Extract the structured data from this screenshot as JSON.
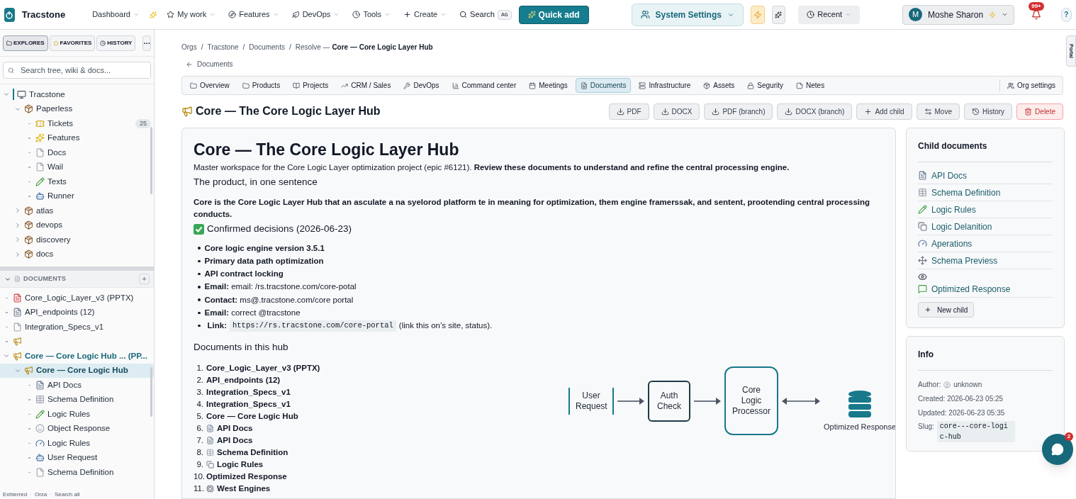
{
  "app": {
    "name": "Tracstone"
  },
  "nav": [
    {
      "label": "Dashboard"
    },
    {
      "label": "My work"
    },
    {
      "label": "Features"
    },
    {
      "label": "DevOps"
    },
    {
      "label": "Tools"
    },
    {
      "label": "Create"
    }
  ],
  "search": {
    "label": "Search",
    "shortcut": "AG"
  },
  "quick_add": {
    "label": "Quick add"
  },
  "system_settings": {
    "label": "System Settings"
  },
  "recent": {
    "label": "Recent"
  },
  "user": {
    "initial": "M",
    "name": "Moshe Sharon"
  },
  "notifications": {
    "count": "99+"
  },
  "help": {
    "label": "?"
  },
  "portal_tab": {
    "label": "Portal"
  },
  "sidebar": {
    "tabs": [
      {
        "label": "EXPLORES",
        "selected": true
      },
      {
        "label": "FAVORITES",
        "selected": false
      },
      {
        "label": "HISTORY",
        "selected": false
      }
    ],
    "more": "···",
    "search_placeholder": "Search tree, wiki & docs...",
    "tree": [
      {
        "label": "Tracstone",
        "kind": "root",
        "expanded": true,
        "selected": false,
        "children": [
          {
            "label": "Paperless",
            "kind": "box",
            "expanded": true,
            "selected": false,
            "children": [
              {
                "label": "Tickets",
                "kind": "ticket",
                "count": "25",
                "selected": false
              },
              {
                "label": "Features",
                "kind": "sparkle",
                "selected": false
              },
              {
                "label": "Docs",
                "kind": "page",
                "selected": false
              },
              {
                "label": "Wail",
                "kind": "page",
                "selected": false
              },
              {
                "label": "Texts",
                "kind": "pencil",
                "selected": false
              },
              {
                "label": "Runner",
                "kind": "robot",
                "selected": false
              }
            ]
          },
          {
            "label": "atlas",
            "kind": "box",
            "expanded": false,
            "selected": false
          },
          {
            "label": "devops",
            "kind": "box",
            "expanded": false,
            "selected": false
          },
          {
            "label": "discovery",
            "kind": "box",
            "expanded": false,
            "selected": false
          },
          {
            "label": "docs",
            "kind": "box",
            "expanded": false,
            "selected": false
          }
        ]
      }
    ],
    "documents_header": "DOCUMENTS",
    "add_label": "+",
    "documents": [
      {
        "label": "Core_Logic_Layer_v3 (PPTX)",
        "kind": "pptx",
        "selected": false
      },
      {
        "label": "API_endpoints (12)",
        "kind": "doc",
        "selected": false
      },
      {
        "label": "Integration_Specs_v1",
        "kind": "page",
        "selected": false
      },
      {
        "kind": "megaphone",
        "selected": false
      },
      {
        "label": "Core — Core Logic Hub ... (PP...",
        "kind": "megaphone",
        "expanded": true,
        "selected": false,
        "children": [
          {
            "label": "Core — Core Logic Hub",
            "kind": "megaphone",
            "expanded": true,
            "selected": true,
            "children": [
              {
                "label": "API Docs",
                "kind": "doc",
                "selected": false
              },
              {
                "label": "Schema Definition",
                "kind": "grid",
                "selected": false
              },
              {
                "label": "Logic Rules",
                "kind": "pencil",
                "selected": false
              },
              {
                "label": "Object Response",
                "kind": "face",
                "selected": false
              },
              {
                "label": "Logic Rules",
                "kind": "gauge",
                "selected": false
              },
              {
                "label": "User Request",
                "kind": "robot",
                "selected": false
              },
              {
                "label": "Schema Definition",
                "kind": "page",
                "selected": false
              }
            ]
          }
        ]
      }
    ],
    "footer": [
      "Exhlerred",
      "Orza",
      "Search all"
    ],
    "footer_separator": "·"
  },
  "breadcrumb": [
    "Orgs",
    "Tracstone",
    "Documents"
  ],
  "breadcrumb_separator": "/",
  "breadcrumb_current": {
    "prefix": "Resolve —",
    "label": "Core — Core Logic Layer Hub"
  },
  "back_link": "Documents",
  "tabs": [
    {
      "label": "Overview",
      "selected": false
    },
    {
      "label": "Products",
      "selected": false
    },
    {
      "label": "Projects",
      "selected": false
    },
    {
      "label": "CRM / Sales",
      "selected": false
    },
    {
      "label": "DevOps",
      "selected": false
    },
    {
      "label": "Command center",
      "selected": false
    },
    {
      "label": "Meetings",
      "selected": false
    },
    {
      "label": "Documents",
      "selected": true
    },
    {
      "label": "Infrastructure",
      "selected": false
    },
    {
      "label": "Assets",
      "selected": false
    },
    {
      "label": "Segurity",
      "selected": false
    },
    {
      "label": "Netes",
      "selected": false
    }
  ],
  "org_settings": "Org settings",
  "page_title": "Core — The Core Logic Layer Hub",
  "actions": [
    {
      "label": "PDF",
      "kind": "download"
    },
    {
      "label": "DOCX",
      "kind": "download"
    },
    {
      "label": "PDF (branch)",
      "kind": "download"
    },
    {
      "label": "DOCX (branch)",
      "kind": "download"
    },
    {
      "label": "Add child",
      "kind": "add"
    },
    {
      "label": "Move",
      "kind": "move"
    },
    {
      "label": "History",
      "kind": "history"
    },
    {
      "label": "Delete",
      "kind": "danger"
    }
  ],
  "document": {
    "title": "Core — The Core Logic Layer Hub",
    "intro": "Master workspace for the Core Logic Layer optimization project (epic #6121). **Review these documents to understand and refine the central processing engine.**",
    "subtitle": "The product, in one sentence",
    "summary": "Core is the Core Logic Layer Hub that an asculate a na syelorod platform te in meaning for optimization, them engine framerssak, and sentent, prootending central processing conducts.",
    "decisions_heading": "Confirmed decisions (2026-06-23)",
    "decisions": [
      {
        "kind": "strong",
        "text": "Core logic engine version 3.5.1"
      },
      {
        "kind": "strong",
        "text": "Primary data path optimization"
      },
      {
        "kind": "strong",
        "text": "API contract locking"
      },
      {
        "kind": "labeled",
        "text": "**Email:** email: /rs.tracstone.com/core-potal"
      },
      {
        "kind": "labeled",
        "text": "**Contact:** ms@.tracstone.com/core portal"
      },
      {
        "kind": "labeled",
        "text": "**Email:** correct @tracstone"
      },
      {
        "kind": "link",
        "label": "Link:",
        "code": "https://rs.tracstone.com/core-portal",
        "after": "(link this on’s site, status)."
      }
    ],
    "hub_heading": "Documents in this hub",
    "hub_docs": [
      {
        "num": "1.",
        "text": "Core_Logic_Layer_v3 (PPTX)"
      },
      {
        "num": "2.",
        "text": "API_endpoints (12)"
      },
      {
        "num": "3.",
        "text": "Integration_Specs_v1"
      },
      {
        "num": "4.",
        "text": "Integration_Specs_v1"
      },
      {
        "num": "5.",
        "text": "Core — Core Logic Hub"
      },
      {
        "num": "6.",
        "text": "API Docs",
        "kind": "doc"
      },
      {
        "num": "7.",
        "text": "API Docs",
        "kind": "doc"
      },
      {
        "num": "8.",
        "text": "Schema Definition",
        "kind": "grid"
      },
      {
        "num": "9.",
        "text": "Logic Rules",
        "kind": "copy"
      },
      {
        "num": "10.",
        "text": "Optimized Response"
      },
      {
        "num": "11.",
        "text": "West Engines",
        "kind": "engine"
      }
    ],
    "diagram": {
      "nodes": [
        {
          "label": "User Request",
          "kind": "bracket"
        },
        {
          "label": "Auth Check",
          "kind": "box"
        },
        {
          "label": "Core Logic Processor",
          "kind": "brace"
        },
        {
          "label": "Optimized Response",
          "kind": "database"
        }
      ],
      "links": [
        {
          "kind": "single"
        },
        {
          "kind": "single"
        },
        {
          "kind": "double"
        }
      ]
    }
  },
  "child_documents": {
    "title": "Child documents",
    "items": [
      {
        "label": "API Docs",
        "kind": "doc"
      },
      {
        "label": "Schema Definition",
        "kind": "grid"
      },
      {
        "label": "Logic Rules",
        "kind": "pencil"
      },
      {
        "label": "Logic Delanition",
        "kind": "copy"
      },
      {
        "label": "Aperations",
        "kind": "gauge"
      },
      {
        "label": "Schema Previess",
        "kind": "move"
      },
      {
        "kind": "eye"
      },
      {
        "label": "Optimized Response",
        "kind": "chat"
      }
    ],
    "new_child": "New child"
  },
  "info": {
    "title": "Info",
    "author_label": "Author:",
    "author": "unknown",
    "created": "Created: 2026-06-23 05:25",
    "updated": "Updated: 2026-06-23 05:35",
    "slug_label": "Slug:",
    "slug": "core---core-logic-hub"
  },
  "chat": {
    "badge": "2"
  }
}
